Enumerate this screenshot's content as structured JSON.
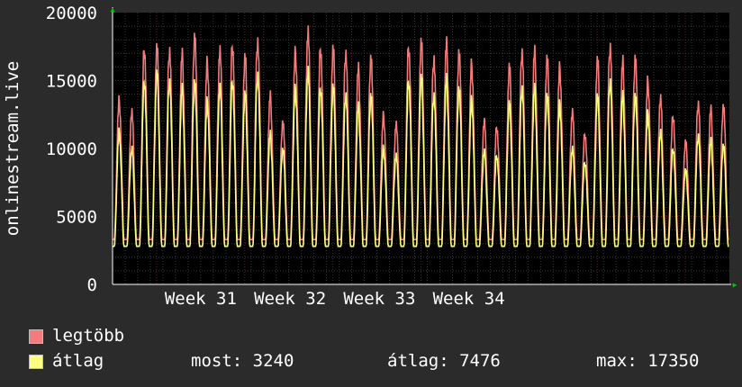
{
  "chart_data": {
    "type": "area",
    "ylabel": "onlinestream.live",
    "ylim": [
      0,
      20000
    ],
    "y_ticks": [
      "0",
      "5000",
      "10000",
      "15000",
      "20000"
    ],
    "x_ticks": [
      "Week 31",
      "Week 32",
      "Week 33",
      "Week 34"
    ],
    "grid": true,
    "series": [
      {
        "name": "legtöbb",
        "color": "#f47c7c",
        "daily_peaks": [
          13500,
          12700,
          17350,
          17400,
          17300,
          16800,
          18400,
          16300,
          17200,
          17600,
          16700,
          18000,
          13800,
          12000,
          17000,
          18600,
          17400,
          17300,
          17100,
          15800,
          16800,
          12400,
          11800,
          17500,
          17800,
          16700,
          17600,
          17200,
          16100,
          12000,
          11600,
          16000,
          17200,
          17000,
          16800,
          15900,
          12700,
          11100,
          16500,
          17600,
          16300,
          16800,
          14900,
          13700,
          12400,
          10500,
          13400,
          12800,
          13200
        ]
      },
      {
        "name": "átlag",
        "color": "#ffff80",
        "daily_peaks": [
          11200,
          10000,
          15000,
          15500,
          15000,
          14300,
          15000,
          13400,
          14500,
          15000,
          14000,
          15500,
          11000,
          10000,
          14300,
          15700,
          14500,
          14500,
          14000,
          13000,
          14000,
          10000,
          9500,
          15000,
          15200,
          14000,
          15000,
          14500,
          13500,
          9800,
          9500,
          13300,
          14500,
          14300,
          14000,
          13200,
          10000,
          9000,
          13800,
          15000,
          13800,
          14000,
          12500,
          11200,
          10000,
          8400,
          11000,
          10500,
          10300
        ]
      }
    ],
    "x_markers": [
      "▲",
      "▶"
    ]
  },
  "legend": {
    "max_label": "legtöbb",
    "avg_label": "átlag",
    "most": "most: 3240",
    "atlag": "átlag: 7476",
    "max": "max: 17350"
  },
  "colors": {
    "background": "#2b2b2b",
    "plot": "#000000",
    "grid_minor": "#3a3a3a",
    "grid_major": "#6a1e1e",
    "axis": "#ffffff",
    "marker": "#00cc00"
  }
}
